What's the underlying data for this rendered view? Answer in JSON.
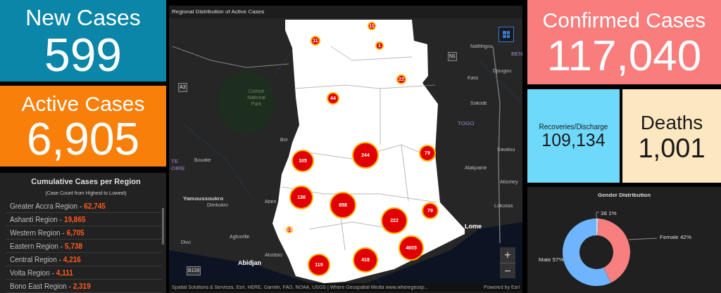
{
  "new_cases": {
    "label": "New Cases",
    "value": "599"
  },
  "active_cases": {
    "label": "Active Cases",
    "value": "6,905"
  },
  "region_list": {
    "title": "Cumulative Cases per Region",
    "subtitle": "(Case Count from Highest to Lowest)",
    "items": [
      {
        "name": "Greater Accra Region -",
        "count": "62,745"
      },
      {
        "name": "Ashanti Region -",
        "count": "19,865"
      },
      {
        "name": "Western Region -",
        "count": "6,705"
      },
      {
        "name": "Eastern Region -",
        "count": "5,738"
      },
      {
        "name": "Central Region -",
        "count": "4,216"
      },
      {
        "name": "Volta Region -",
        "count": "4,111"
      },
      {
        "name": "Bono East Region -",
        "count": "2,319"
      }
    ]
  },
  "map": {
    "title": "Regional Distribution of Active Cases",
    "markers": [
      "11",
      "11",
      "1",
      "22",
      "44",
      "105",
      "244",
      "79",
      "136",
      "658",
      "79",
      "10",
      "222",
      "4605",
      "119",
      "418"
    ],
    "place_labels": [
      "Comoé National Park",
      "A3",
      "N1",
      "Natitingou",
      "BEN",
      "Djougou",
      "Kara",
      "Sokode",
      "TOGO",
      "Bor",
      "Savalou",
      "Bouake",
      "TE",
      "OIRE",
      "Atakpamé",
      "Abomey",
      "Yamoussoukro",
      "Dimbokro",
      "Aben",
      "Lokossa",
      "Lome",
      "Agboville",
      "Divo",
      "Abidjan",
      "Aboisso",
      "B139"
    ],
    "attribution": "Spatial Solutions & Services, Esri, HERE, Garmin, FAO, NOAA, USGS | Where Geospatial Media www.wheregeosp...",
    "powered_by": "Powered by Esri",
    "zoom_in": "+",
    "zoom_out": "−"
  },
  "confirmed": {
    "label": "Confirmed Cases",
    "value": "117,040"
  },
  "recoveries": {
    "label": "Recoveries/Discharge",
    "value": "109,134"
  },
  "deaths": {
    "label": "Deaths",
    "value": "1,001"
  },
  "gender": {
    "title": "Gender Distribution",
    "value_suffix": "%",
    "chart_data": {
      "type": "donut",
      "categories": [
        "Male",
        "Female",
        "38"
      ],
      "values": [
        57,
        42,
        1
      ],
      "colors": [
        "#6eb4ff",
        "#f77f7f",
        "#d9d9d9"
      ],
      "data_labels": true
    }
  }
}
